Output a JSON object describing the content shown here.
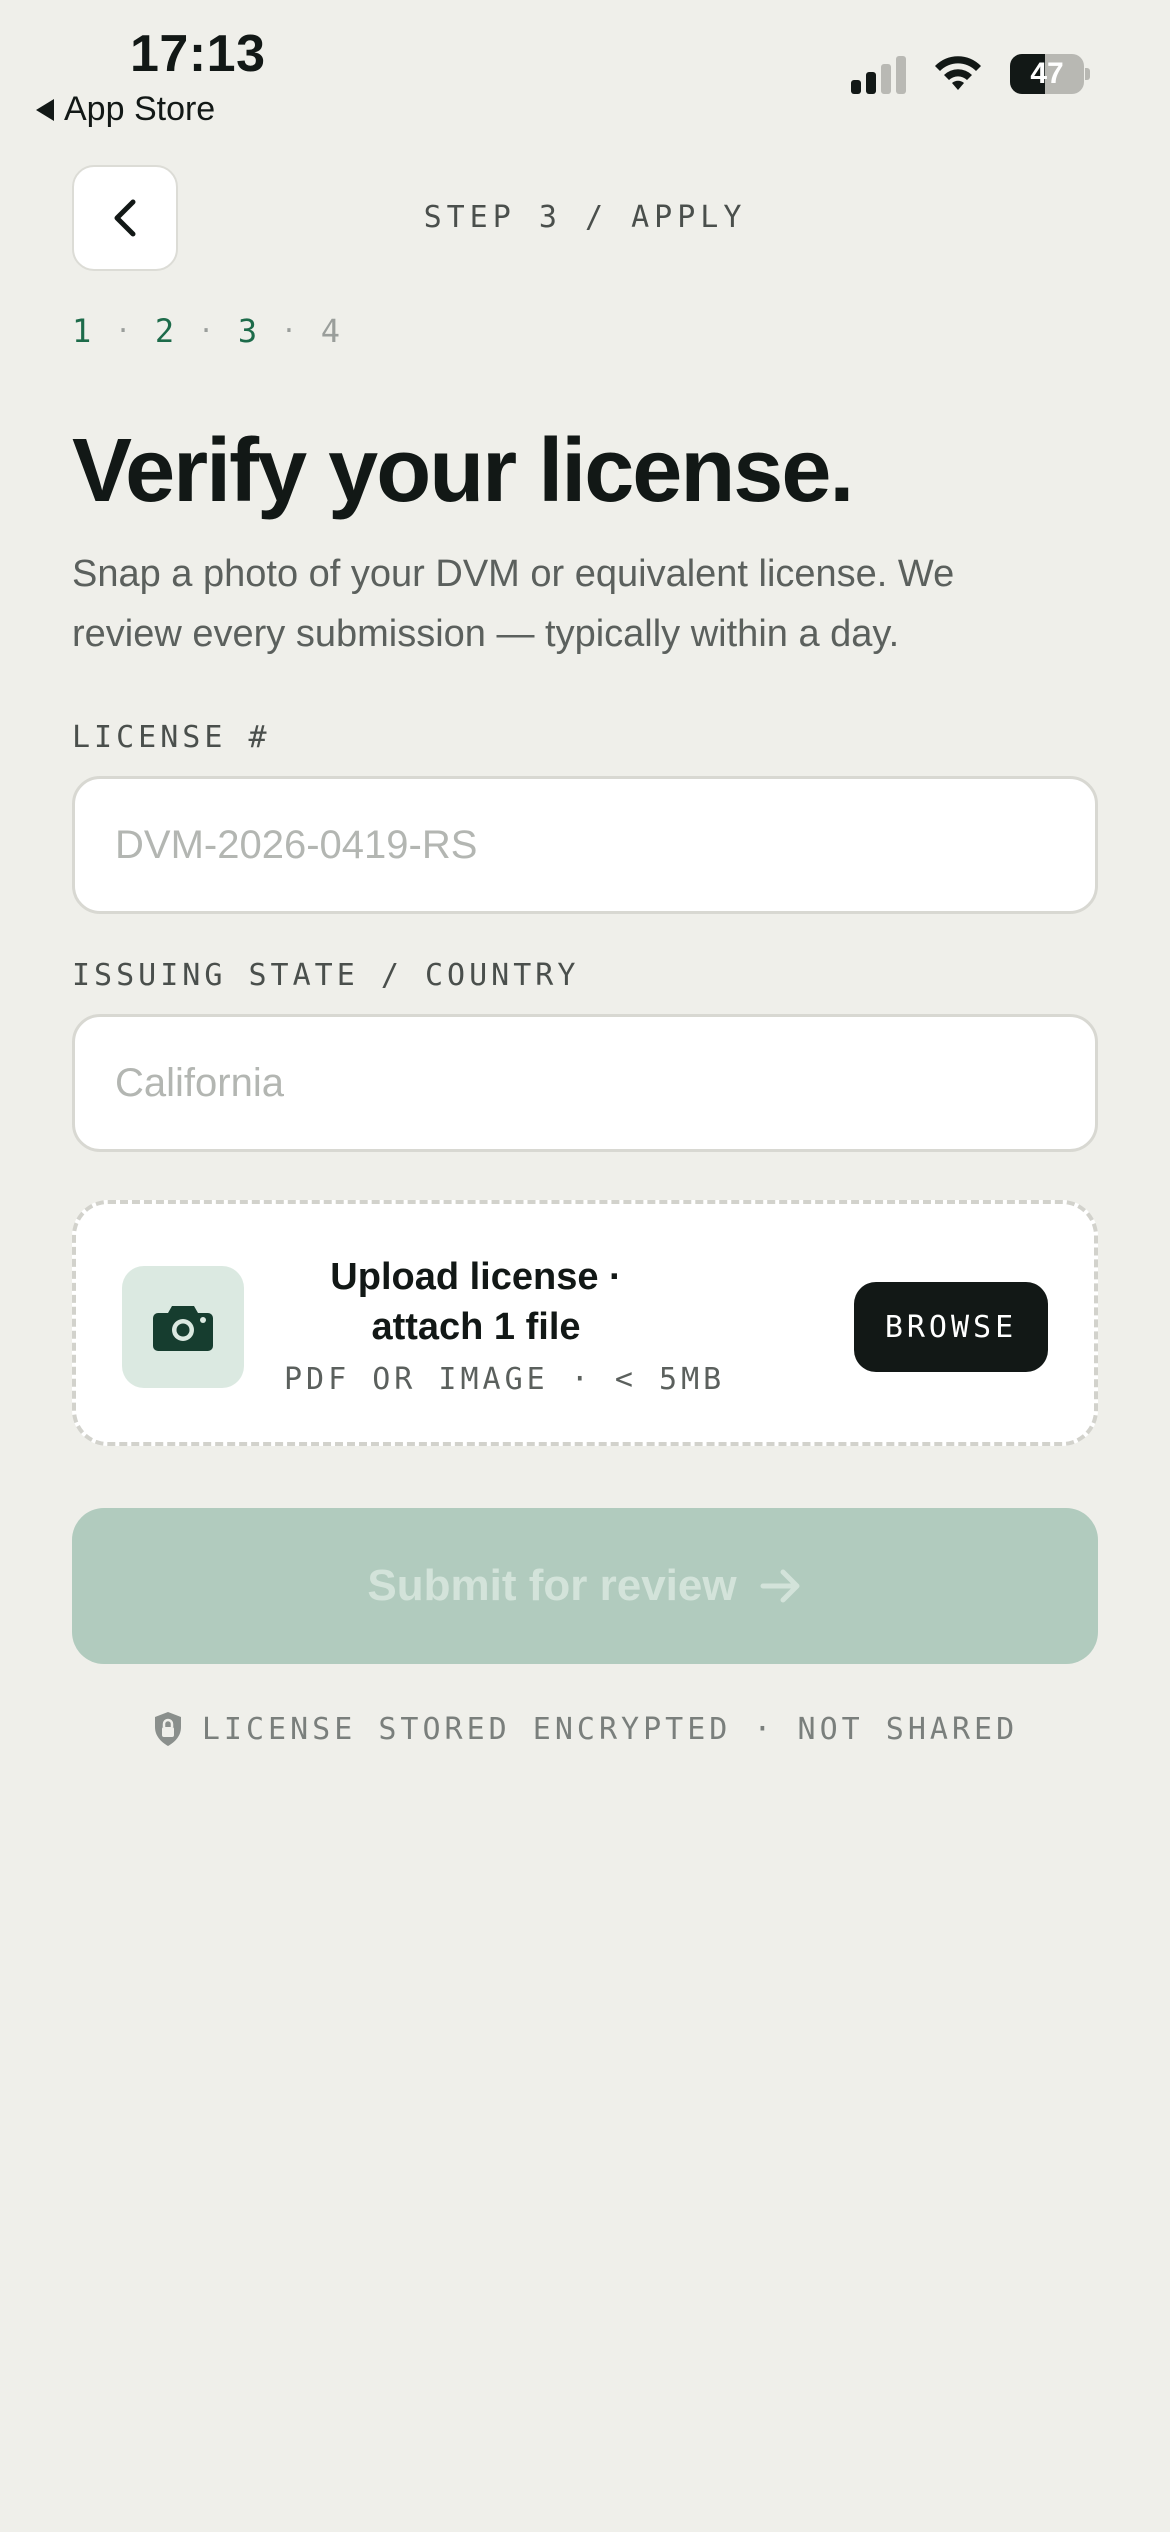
{
  "status_bar": {
    "time": "17:13",
    "back_app": "App Store",
    "battery": "47",
    "battery_level": 0.47
  },
  "header": {
    "step_label": "STEP 3 / APPLY"
  },
  "progress": {
    "steps": [
      "1",
      "2",
      "3",
      "4"
    ],
    "separator": "·",
    "current": 3
  },
  "main": {
    "title": "Verify your license.",
    "subtitle": "Snap a photo of your DVM or equivalent license. We review every submission — typically within a day."
  },
  "form": {
    "license_label": "LICENSE #",
    "license_placeholder": "DVM-2026-0419-RS",
    "license_value": "",
    "state_label": "ISSUING STATE / COUNTRY",
    "state_placeholder": "California",
    "state_value": ""
  },
  "upload": {
    "title": "Upload license · attach 1 file",
    "meta": "PDF OR IMAGE · < 5MB",
    "browse_label": "BROWSE",
    "icon": "camera-icon"
  },
  "submit": {
    "label": "Submit for review",
    "icon": "arrow-right-icon",
    "enabled": false
  },
  "footer": {
    "secure_note": "LICENSE STORED ENCRYPTED · NOT SHARED",
    "icon": "shield-lock-icon"
  },
  "colors": {
    "background": "#efefea",
    "accent": "#1d6b4a",
    "submit_disabled": "#b1cbbe",
    "text_primary": "#121816"
  }
}
